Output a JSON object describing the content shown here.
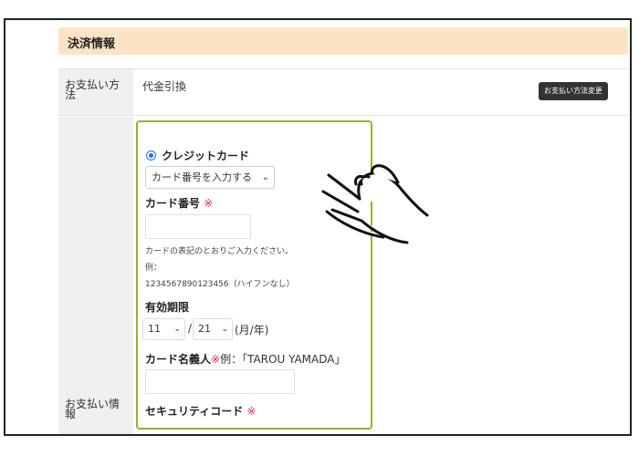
{
  "section_title": "決済情報",
  "payment_method": {
    "label": "お支払い方法",
    "value": "代金引換",
    "change_button": "お支払い方法変更"
  },
  "payment_info": {
    "label": "お支払い情報",
    "radio_label": "クレジットカード",
    "card_select": "カード番号を入力する",
    "card_number_label": "カード番号",
    "required_mark": "※",
    "card_number_value": "",
    "help_line1": "カードの表記のとおりご入力ください。",
    "help_line2": "例：",
    "help_line3": "1234567890123456（ハイフンなし）",
    "expiry_label": "有効期限",
    "expiry_month": "11",
    "expiry_slash": "/",
    "expiry_year": "21",
    "expiry_unit": "(月/年)",
    "holder_label": "カード名義人",
    "holder_example": "例：「TAROU YAMADA」",
    "holder_value": "",
    "security_label": "セキュリティコード"
  },
  "icons": {
    "chevron": "chevron-down-icon",
    "hand": "hand-pointer-icon"
  }
}
